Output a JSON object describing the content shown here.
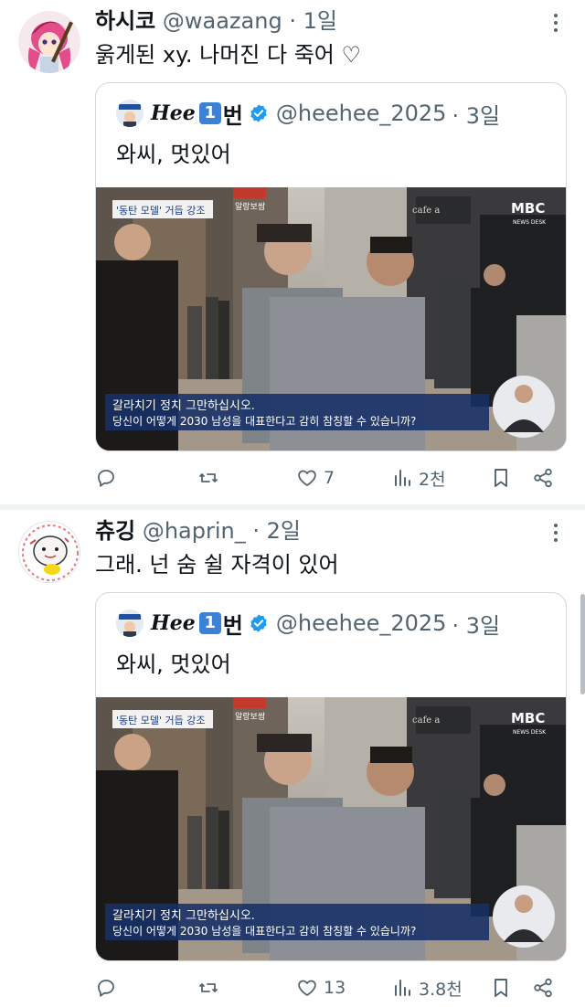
{
  "tweets": [
    {
      "name": "하시코",
      "handle": "@waazang",
      "time": "· 1일",
      "text": "욹게된 xy. 나머진 다 죽어 ♡",
      "quote": {
        "name_script": "Hee",
        "name_num": "1",
        "name_rest": "번",
        "handle": "@heehee_2025",
        "time": "· 3일",
        "text": "와씨, 멋있어",
        "media": {
          "caption_tag": "'동탄 모델' 거듭 강조",
          "sign": "알랑보쌈",
          "logo": "MBC",
          "logo_sub": "NEWS DESK",
          "store_sign": "cafe a",
          "subtitle_line1": "갈라치기 정치 그만하십시오.",
          "subtitle_line2": "당신이 어떻게 2030 남성을 대표한다고 감히 참칭할 수 있습니까?"
        }
      },
      "stats": {
        "replies": "",
        "retweets": "",
        "likes": "7",
        "views": "2천"
      }
    },
    {
      "name": "츄깅",
      "handle": "@haprin_",
      "time": "· 2일",
      "text": "그래. 넌 숨 쉴 자격이 있어",
      "quote": {
        "name_script": "Hee",
        "name_num": "1",
        "name_rest": "번",
        "handle": "@heehee_2025",
        "time": "· 3일",
        "text": "와씨, 멋있어",
        "media": {
          "caption_tag": "'동탄 모델' 거듭 강조",
          "sign": "알랑보쌈",
          "logo": "MBC",
          "logo_sub": "NEWS DESK",
          "store_sign": "cafe a",
          "subtitle_line1": "갈라치기 정치 그만하십시오.",
          "subtitle_line2": "당신이 어떻게 2030 남성을 대표한다고 감히 참칭할 수 있습니까?"
        }
      },
      "stats": {
        "replies": "",
        "retweets": "",
        "likes": "13",
        "views": "3.8천"
      }
    }
  ],
  "icons": {
    "reply": "reply-icon",
    "retweet": "retweet-icon",
    "like": "heart-icon",
    "views": "views-icon",
    "bookmark": "bookmark-icon",
    "share": "share-icon",
    "verified": "verified-badge-icon",
    "more": "more-icon"
  },
  "colors": {
    "verified": "#1d9bf0",
    "muted": "#536471",
    "border": "#cfd9de",
    "badge": "#3b82d6"
  }
}
